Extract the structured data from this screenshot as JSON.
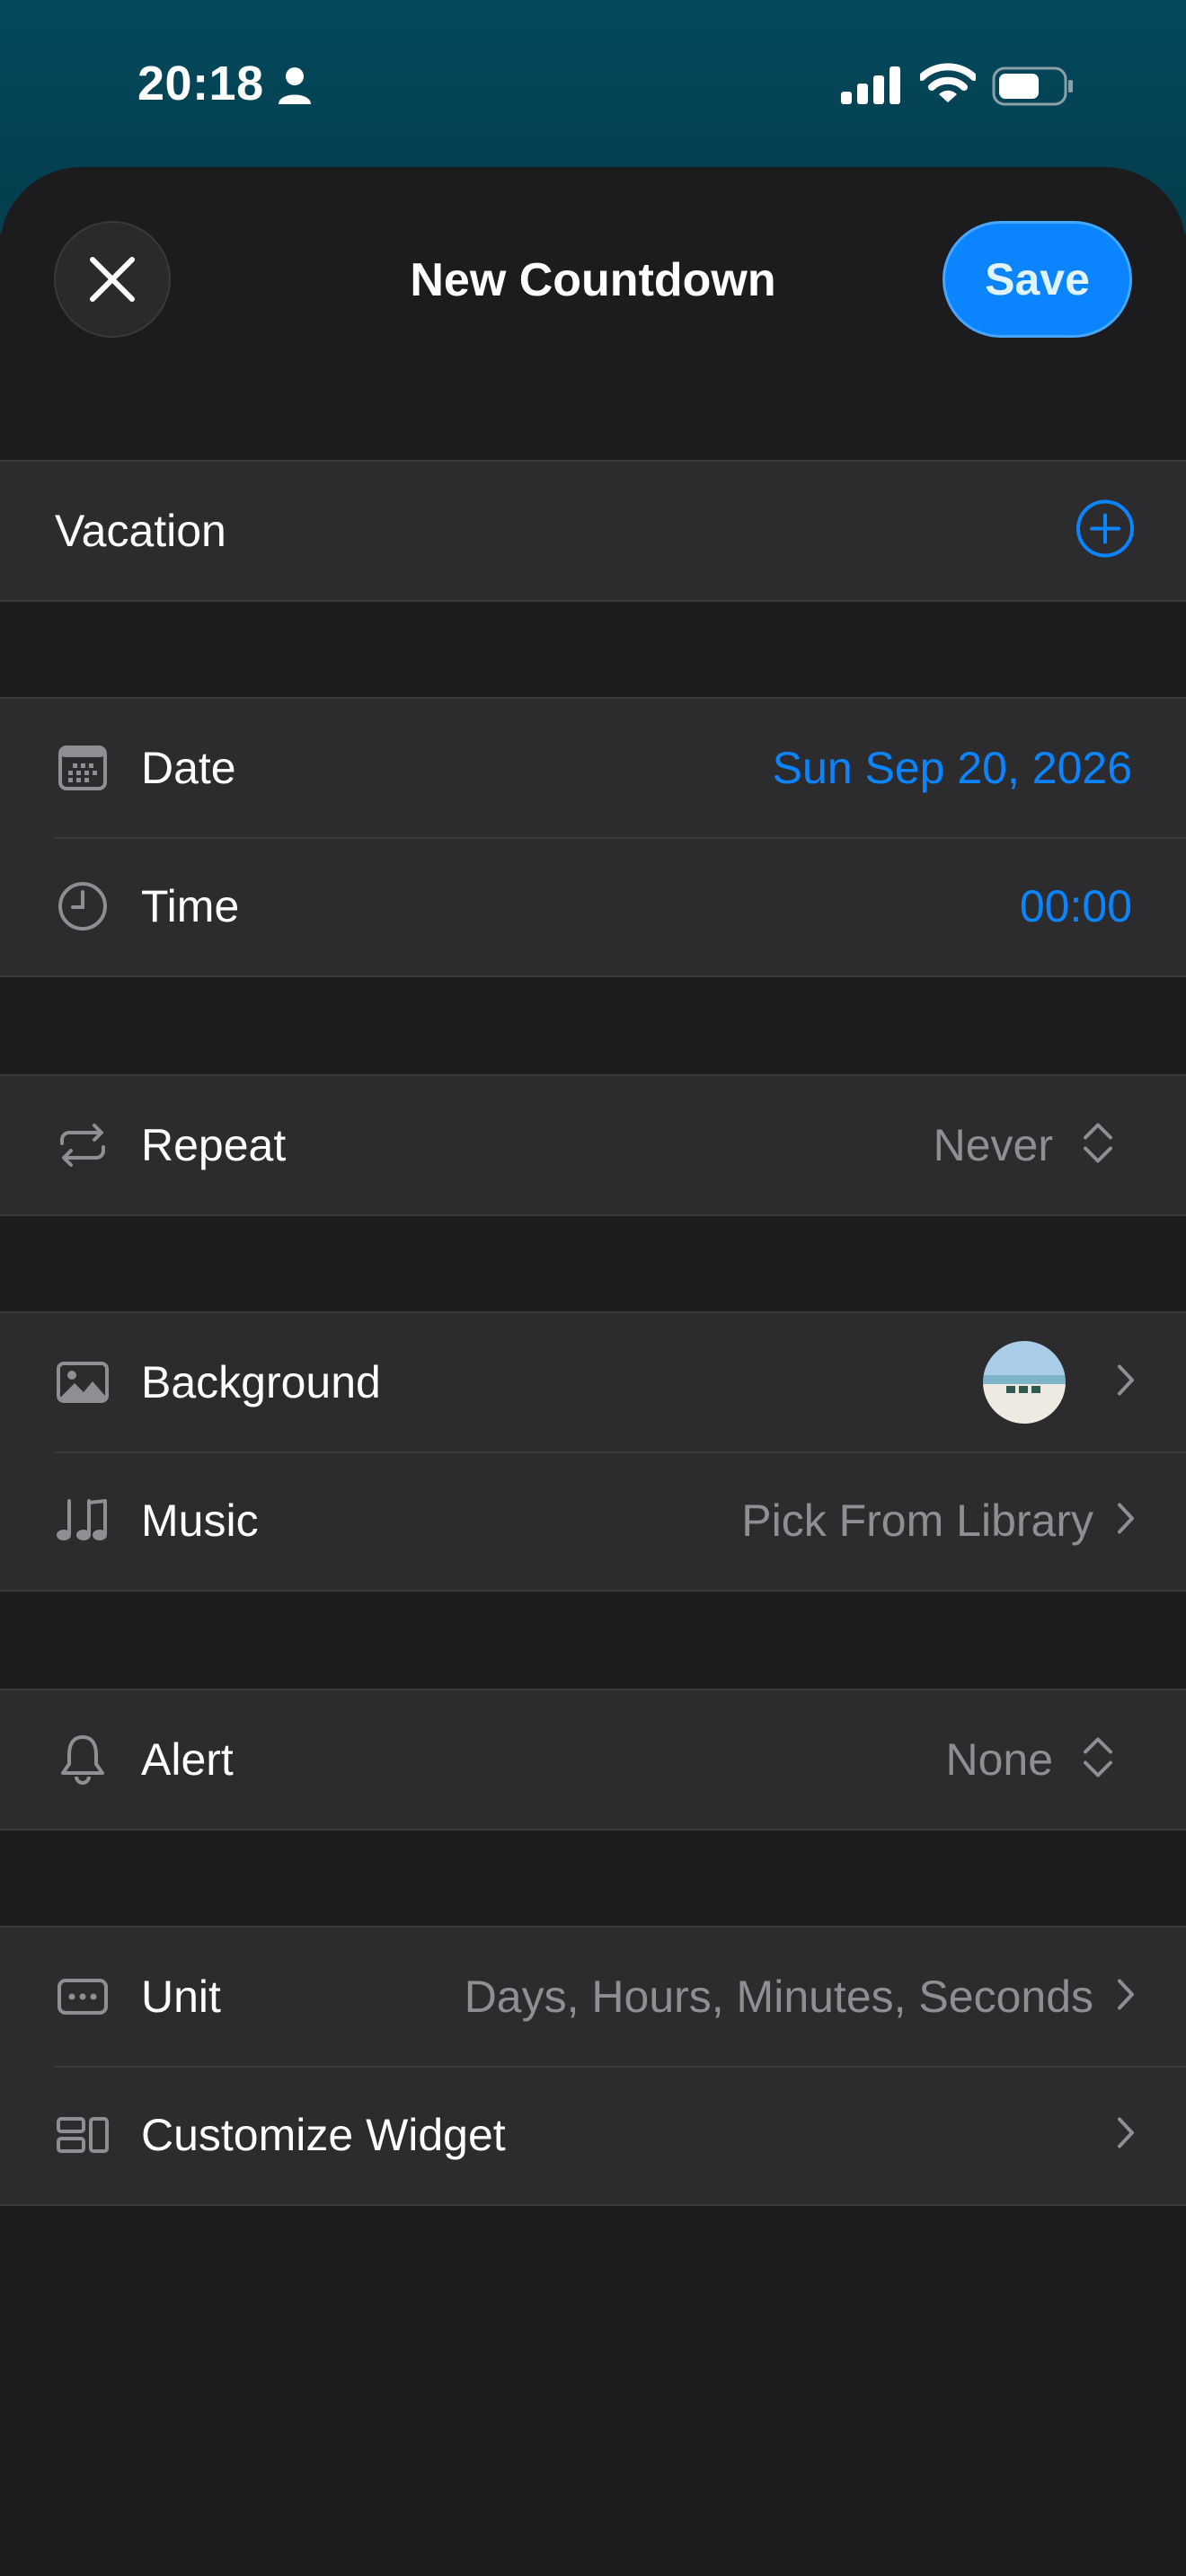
{
  "status_bar": {
    "time": "20:18",
    "icons": [
      "person-icon",
      "cellular-signal-icon",
      "wifi-icon",
      "battery-icon"
    ]
  },
  "header": {
    "title": "New Countdown",
    "close_icon": "close-icon",
    "save_label": "Save"
  },
  "name_row": {
    "value": "Vacation",
    "icon": "plus-circle-icon"
  },
  "datetime": {
    "date_label": "Date",
    "date_value": "Sun Sep 20, 2026",
    "time_label": "Time",
    "time_value": "00:00"
  },
  "repeat": {
    "label": "Repeat",
    "value": "Never"
  },
  "media": {
    "background_label": "Background",
    "music_label": "Music",
    "music_value": "Pick From Library"
  },
  "alert": {
    "label": "Alert",
    "value": "None"
  },
  "display": {
    "unit_label": "Unit",
    "unit_value": "Days, Hours, Minutes, Seconds",
    "widget_label": "Customize Widget"
  },
  "colors": {
    "accent": "#0a84ff",
    "sheet": "#1c1c1e",
    "cell": "#2c2c2e",
    "secondary_text": "#8e8e93",
    "status_bg": "#03495e"
  }
}
